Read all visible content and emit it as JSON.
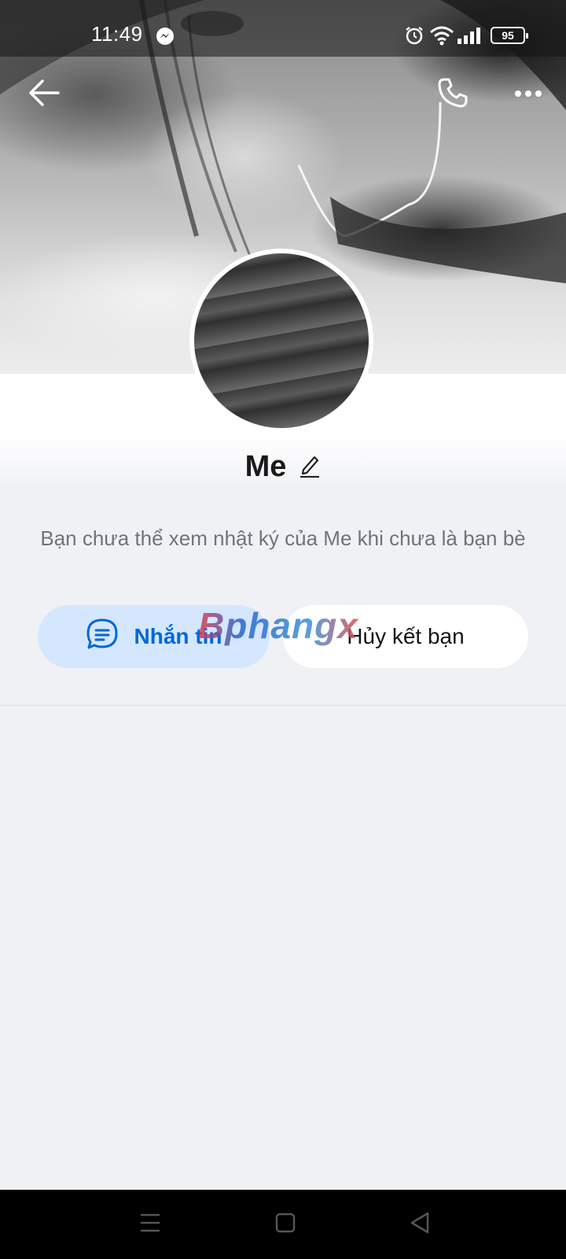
{
  "status_bar": {
    "time": "11:49",
    "battery": "95",
    "icons": [
      "messenger-icon",
      "alarm-icon",
      "wifi-icon",
      "signal-icon",
      "battery-icon"
    ]
  },
  "top_bar": {
    "icons": [
      "back-arrow-icon",
      "phone-icon",
      "more-icon"
    ]
  },
  "profile": {
    "name": "Me",
    "notice": "Bạn chưa thể xem nhật ký của Me khi chưa là bạn bè"
  },
  "actions": {
    "message_label": "Nhắn tin",
    "unfriend_label": "Hủy kết bạn"
  },
  "watermark": "Bphangx",
  "system_nav": {
    "icons": [
      "menu-icon",
      "home-icon",
      "back-icon"
    ]
  },
  "colors": {
    "background": "#eff1f5",
    "accent": "#0068d6",
    "message_button_bg": "#d4e7ff",
    "text_primary": "#1a1a1a",
    "text_secondary": "#6f7479"
  }
}
